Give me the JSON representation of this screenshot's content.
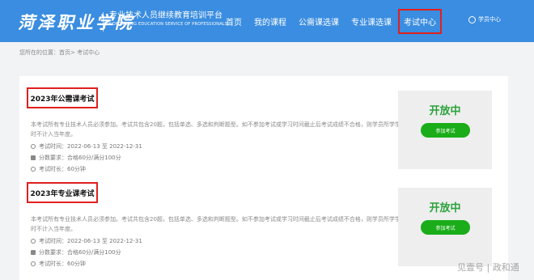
{
  "header": {
    "logo": "菏泽职业学院",
    "subtitle_cn": "专业技术人员继续教育培训平台",
    "subtitle_en": "CONTINUING EDUCATION SERVICE OF PROFESSIONALS",
    "nav": [
      "首页",
      "我的课程",
      "公需课选课",
      "专业课选课",
      "考试中心"
    ],
    "active_nav": "考试中心",
    "user_label": "学员中心",
    "user_icon": "user-icon"
  },
  "breadcrumb": "您所在的位置：首页> 考试中心",
  "exams": [
    {
      "title": "2023年公需课考试",
      "description": "本考试所有专业技术人员必须参加。考试共包含20题，包括单选、多选和判断题型。如不参加考试或学习时间截止后考试成绩不合格，则学员所学学时不计入当年度。",
      "time_label": "考试时间：",
      "time_value": "2022-06-13 至 2022-12-31",
      "score_label": "分数要求：",
      "score_value": "合格60分/满分100分",
      "duration_label": "考试时长：",
      "duration_value": "60分钟",
      "status": "开放中",
      "button": "参加考试"
    },
    {
      "title": "2023年专业课考试",
      "description": "本考试所有专业技术人员必须参加。考试共包含20题，包括单选、多选和判断题型。如不参加考试或学习时间截止后考试成绩不合格，则学员所学学时不计入当年度。",
      "time_label": "考试时间：",
      "time_value": "2022-06-13 至 2022-12-31",
      "score_label": "分数要求：",
      "score_value": "合格60分/满分100分",
      "duration_label": "考试时长：",
      "duration_value": "60分钟",
      "status": "开放中",
      "button": "参加考试"
    }
  ],
  "watermark": "见壹号 | 政和通",
  "colors": {
    "header": "#3a8de0",
    "highlight": "#e0201e",
    "status": "#2aa33a",
    "button": "#1aad19"
  }
}
